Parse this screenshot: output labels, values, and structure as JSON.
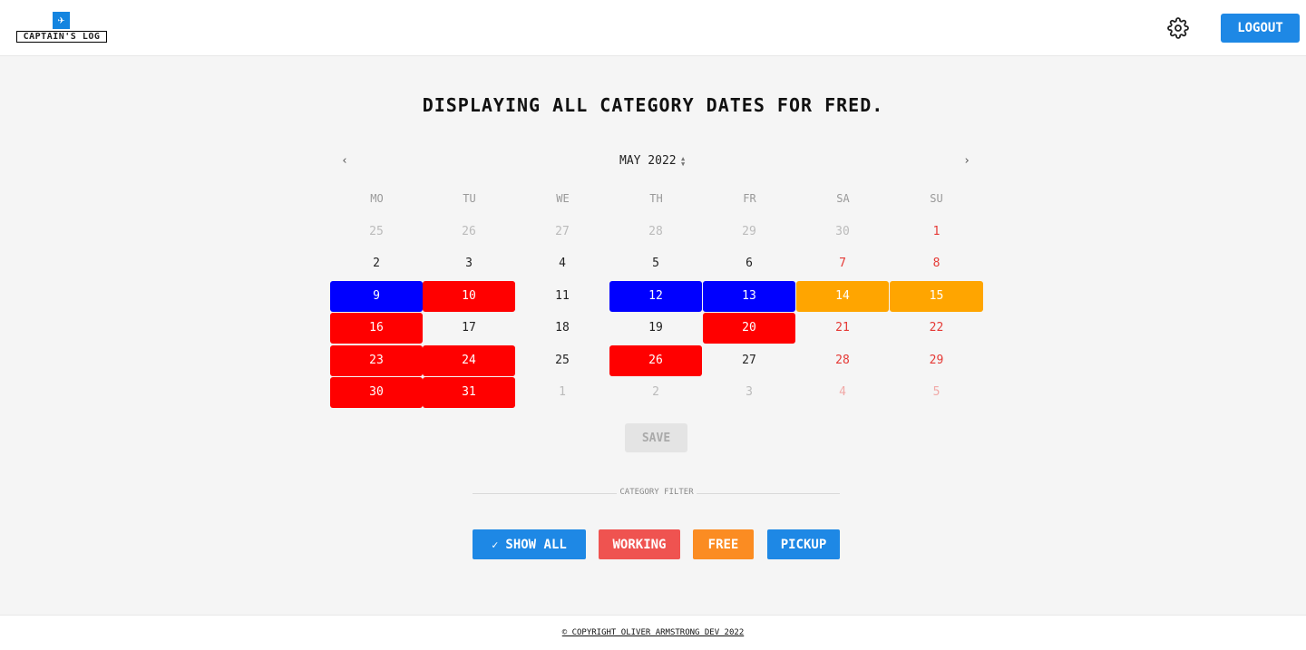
{
  "header": {
    "logo_text": "Captain's Log",
    "logout_label": "Logout"
  },
  "title": "Displaying all category dates for fred.",
  "calendar": {
    "month_label": "May 2022",
    "weekdays": [
      "Mo",
      "Tu",
      "We",
      "Th",
      "Fr",
      "Sa",
      "Su"
    ],
    "weeks": [
      [
        {
          "d": "25",
          "o": true
        },
        {
          "d": "26",
          "o": true
        },
        {
          "d": "27",
          "o": true
        },
        {
          "d": "28",
          "o": true
        },
        {
          "d": "29",
          "o": true
        },
        {
          "d": "30",
          "o": true
        },
        {
          "d": "1",
          "w": true
        }
      ],
      [
        {
          "d": "2"
        },
        {
          "d": "3"
        },
        {
          "d": "4"
        },
        {
          "d": "5"
        },
        {
          "d": "6"
        },
        {
          "d": "7",
          "w": true
        },
        {
          "d": "8",
          "w": true
        }
      ],
      [
        {
          "d": "9",
          "c": "pickup"
        },
        {
          "d": "10",
          "c": "working"
        },
        {
          "d": "11"
        },
        {
          "d": "12",
          "c": "pickup"
        },
        {
          "d": "13",
          "c": "pickup"
        },
        {
          "d": "14",
          "w": true,
          "c": "free"
        },
        {
          "d": "15",
          "w": true,
          "c": "free"
        }
      ],
      [
        {
          "d": "16",
          "c": "working"
        },
        {
          "d": "17"
        },
        {
          "d": "18"
        },
        {
          "d": "19"
        },
        {
          "d": "20",
          "c": "working"
        },
        {
          "d": "21",
          "w": true
        },
        {
          "d": "22",
          "w": true
        }
      ],
      [
        {
          "d": "23",
          "c": "working"
        },
        {
          "d": "24",
          "c": "working"
        },
        {
          "d": "25"
        },
        {
          "d": "26",
          "c": "working"
        },
        {
          "d": "27"
        },
        {
          "d": "28",
          "w": true
        },
        {
          "d": "29",
          "w": true
        }
      ],
      [
        {
          "d": "30",
          "c": "working"
        },
        {
          "d": "31",
          "c": "working"
        },
        {
          "d": "1",
          "o": true
        },
        {
          "d": "2",
          "o": true
        },
        {
          "d": "3",
          "o": true
        },
        {
          "d": "4",
          "o": true,
          "w": true
        },
        {
          "d": "5",
          "o": true,
          "w": true
        }
      ]
    ],
    "category_colors": {
      "working": "#ff0000",
      "pickup": "#0000ff",
      "free": "#ffa500"
    }
  },
  "save_label": "Save",
  "filter": {
    "label": "Category Filter",
    "buttons": [
      {
        "label": "Show All",
        "color": "#1e88e5",
        "selected": true
      },
      {
        "label": "Working",
        "color": "#ef5350"
      },
      {
        "label": "Free",
        "color": "#fb8c22"
      },
      {
        "label": "Pickup",
        "color": "#1e88e5"
      }
    ]
  },
  "footer": {
    "copyright": "© Copyright Oliver Armstrong Dev 2022"
  }
}
